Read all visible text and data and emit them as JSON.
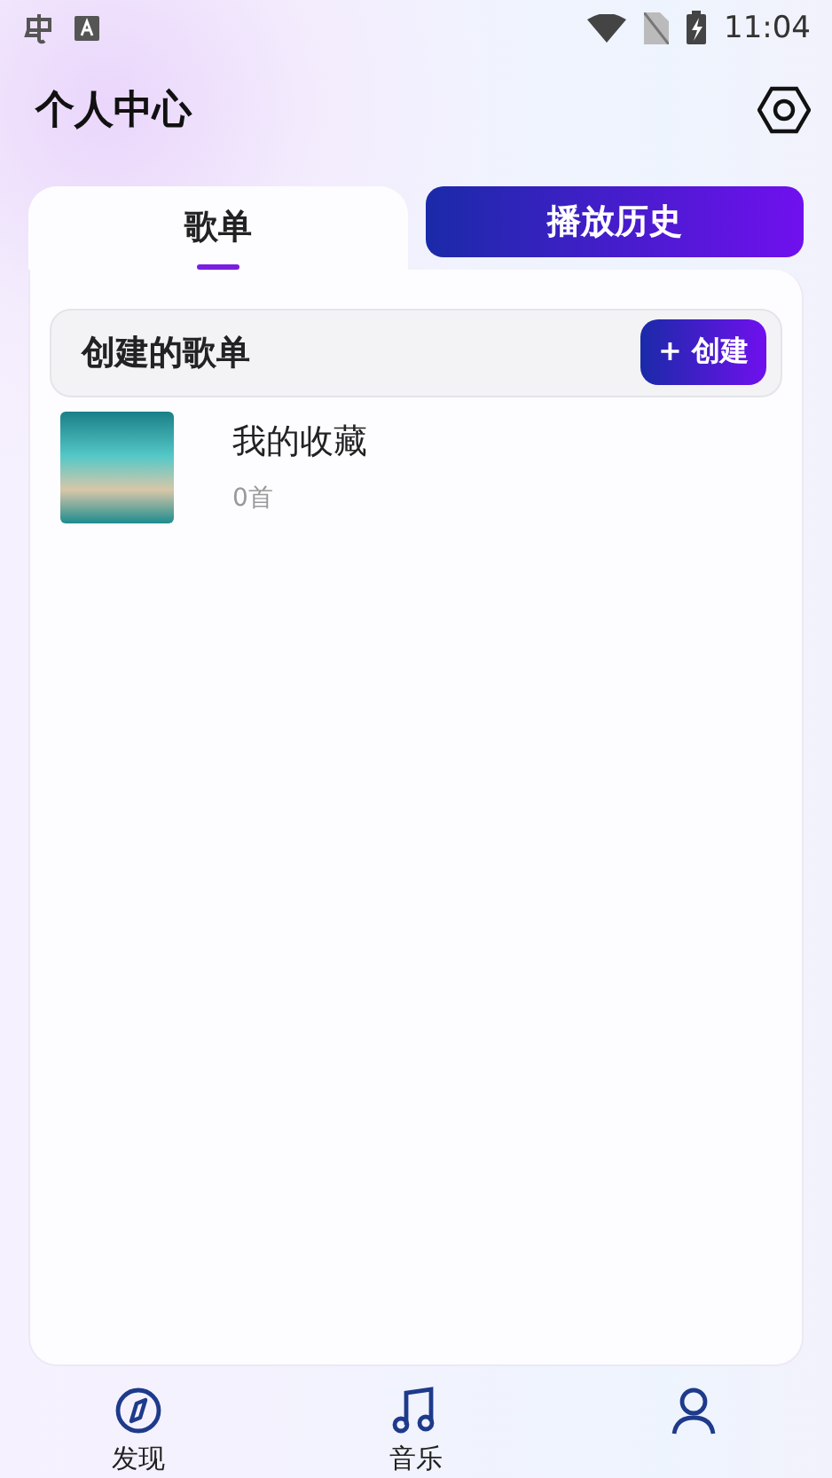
{
  "status_bar": {
    "time": "11:04"
  },
  "header": {
    "title": "个人中心"
  },
  "tabs": [
    {
      "label": "歌单",
      "selected": true
    },
    {
      "label": "播放历史",
      "selected": false
    }
  ],
  "section": {
    "title": "创建的歌单",
    "create_button": "+ 创建"
  },
  "playlists": [
    {
      "name": "我的收藏",
      "count": "0首"
    }
  ],
  "bottom_nav": [
    {
      "kind": "compass",
      "label": "发现"
    },
    {
      "kind": "music",
      "label": "音乐"
    },
    {
      "kind": "person"
    }
  ]
}
